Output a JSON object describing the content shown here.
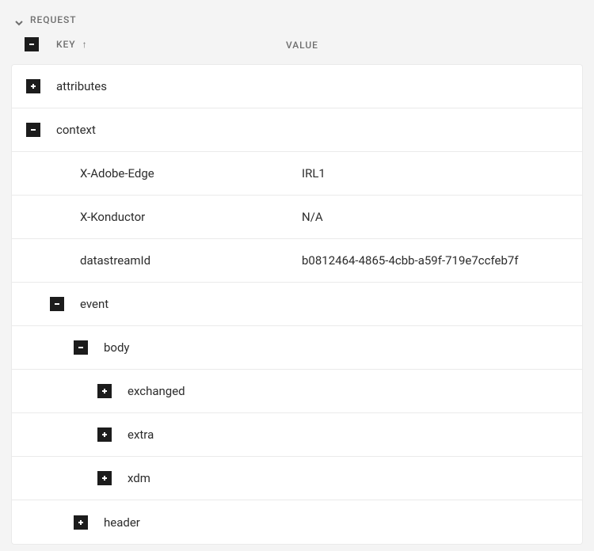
{
  "section": {
    "title": "REQUEST"
  },
  "columns": {
    "key": "KEY",
    "value": "VALUE"
  },
  "rows": {
    "attributes": {
      "key": "attributes"
    },
    "context": {
      "key": "context"
    },
    "xAdobeEdge": {
      "key": "X-Adobe-Edge",
      "value": "IRL1"
    },
    "xKonductor": {
      "key": "X-Konductor",
      "value": "N/A"
    },
    "datastreamId": {
      "key": "datastreamId",
      "value": "b0812464-4865-4cbb-a59f-719e7ccfeb7f"
    },
    "event": {
      "key": "event"
    },
    "body": {
      "key": "body"
    },
    "exchanged": {
      "key": "exchanged"
    },
    "extra": {
      "key": "extra"
    },
    "xdm": {
      "key": "xdm"
    },
    "header": {
      "key": "header"
    }
  }
}
